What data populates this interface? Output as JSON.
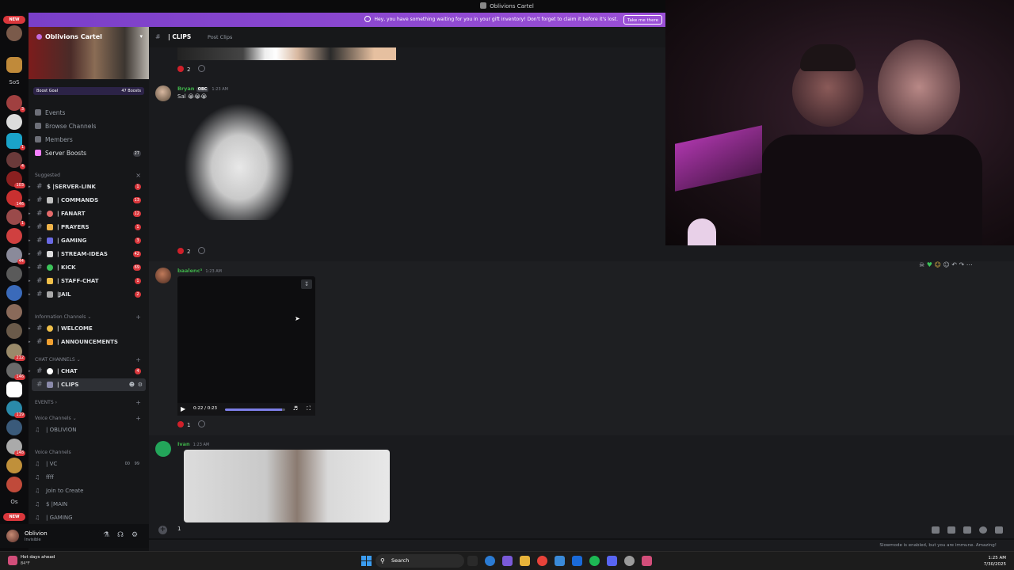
{
  "window": {
    "title": "Oblivions Cartel"
  },
  "gift_banner": {
    "text": "Hey, you have something waiting for you in your gift inventory! Don't forget to claim it before it's lost.",
    "button": "Take me there"
  },
  "rail": {
    "new_top": "NEW",
    "new_bottom": "NEW",
    "labels": [
      "SoS",
      "Os"
    ],
    "badges": [
      "3",
      "1",
      "4",
      "103",
      "146",
      "1",
      "44",
      "212",
      "146",
      "119",
      "148"
    ]
  },
  "server": {
    "name": "Oblivions Cartel",
    "boost_goal": "Boost Goal",
    "boost_count": "47 Boosts",
    "nav": [
      {
        "label": "Events",
        "icon": "calendar-icon"
      },
      {
        "label": "Browse Channels",
        "icon": "browse-icon"
      },
      {
        "label": "Members",
        "icon": "members-icon"
      },
      {
        "label": "Server Boosts",
        "icon": "boost-icon",
        "count": "27"
      }
    ],
    "cat_suggested": "Suggested",
    "cat_info": "Information Channels",
    "cat_chat": "CHAT CHANNELS",
    "cat_events": "EVENTS",
    "cat_voice1": "Voice Channels",
    "cat_voice2": "Voice Channels",
    "channels_suggested": [
      {
        "label": "$ |SERVER-LINK",
        "badge": "1",
        "color": "#8a8a8a"
      },
      {
        "label": "| COMMANDS",
        "badge": "13",
        "color": "#c0c0c0"
      },
      {
        "label": "| FANART",
        "badge": "12",
        "color": "#e46a6a"
      },
      {
        "label": "| PRAYERS",
        "badge": "1",
        "color": "#f0b44a"
      },
      {
        "label": "| GAMING",
        "badge": "3",
        "color": "#6a6ae4"
      },
      {
        "label": "| STREAM-IDEAS",
        "badge": "42",
        "color": "#dddddd"
      },
      {
        "label": "| KICK",
        "badge": "69",
        "color": "#3cc45a"
      },
      {
        "label": "| STAFF-CHAT",
        "badge": "1",
        "color": "#f0c04a"
      },
      {
        "label": "|JAIL",
        "badge": "2",
        "color": "#aaaaaa"
      }
    ],
    "channels_info": [
      {
        "label": "| WELCOME",
        "color": "#f0c04a"
      },
      {
        "label": "| ANNOUNCEMENTS",
        "color": "#f0a030"
      }
    ],
    "channels_chat": [
      {
        "label": "| CHAT",
        "badge": "4",
        "color": "#ffffff"
      },
      {
        "label": "| CLIPS",
        "color": "#8a8aaa"
      }
    ],
    "voice_event": [
      {
        "label": "| OBLIVION"
      }
    ],
    "voice_main": [
      {
        "label": "| VC",
        "extra_a": "00",
        "extra_b": "99"
      },
      {
        "label": "ffff"
      },
      {
        "label": "Join to Create"
      },
      {
        "label": "$ |MAIN"
      },
      {
        "label": "| GAMING"
      }
    ]
  },
  "user": {
    "name": "Oblivion",
    "status": "Invisible"
  },
  "channel": {
    "hash": "#",
    "name": "| CLIPS",
    "post_clips": "Post Clips"
  },
  "messages": [
    {
      "reaction_count": "2"
    },
    {
      "author": "Bryan",
      "tag": "OBC",
      "time": "1:23 AM",
      "text": "Sal 😭😭😭",
      "reaction_count": "2",
      "author_color": "#3fb04a"
    },
    {
      "author": "baalenc³",
      "time": "1:23 AM",
      "reaction_count": "1",
      "author_color": "#3fb04a",
      "video_time": "0:22 / 0:23",
      "video_progress": 0.95
    },
    {
      "author": "Ivan",
      "time": "1:23 AM",
      "author_color": "#3fb04a"
    }
  ],
  "composer": {
    "value": "1"
  },
  "slowmode": "Slowmode is enabled, but you are immune. Amazing!",
  "taskbar": {
    "weather_title": "Hot days ahead",
    "weather_temp": "84°F",
    "search": "Search",
    "time": "1:25 AM",
    "date": "7/30/2025"
  }
}
